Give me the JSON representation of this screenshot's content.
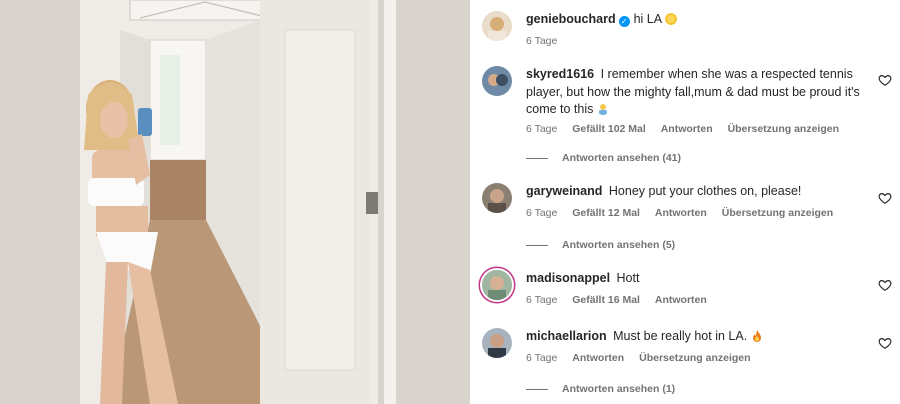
{
  "post": {
    "username": "geniebouchard",
    "caption": "hi LA",
    "caption_emoji": "sun-emoji",
    "time": "6 Tage"
  },
  "comments": [
    {
      "username": "skyred1616",
      "text": "I remember when she was a respected tennis player, but how the mighty fall,mum & dad must be proud it's come to this",
      "emoji": "person-shrugging-emoji",
      "time": "6 Tage",
      "likes": "Gefällt 102 Mal",
      "reply": "Antworten",
      "translate": "Übersetzung anzeigen",
      "view_replies": "Antworten ansehen (41)"
    },
    {
      "username": "garyweinand",
      "text": "Honey put your clothes on, please!",
      "time": "6 Tage",
      "likes": "Gefällt 12 Mal",
      "reply": "Antworten",
      "translate": "Übersetzung anzeigen",
      "view_replies": "Antworten ansehen (5)"
    },
    {
      "username": "madisonappel",
      "text": "Hott",
      "time": "6 Tage",
      "likes": "Gefällt 16 Mal",
      "reply": "Antworten"
    },
    {
      "username": "michaellarion",
      "text": "Must be really hot in LA.",
      "emoji": "fire-emoji",
      "time": "6 Tage",
      "reply": "Antworten",
      "translate": "Übersetzung anzeigen",
      "view_replies": "Antworten ansehen (1)"
    }
  ],
  "colors": {
    "verified": "#0095f6",
    "meta_text": "#737373",
    "primary_text": "#262626"
  }
}
